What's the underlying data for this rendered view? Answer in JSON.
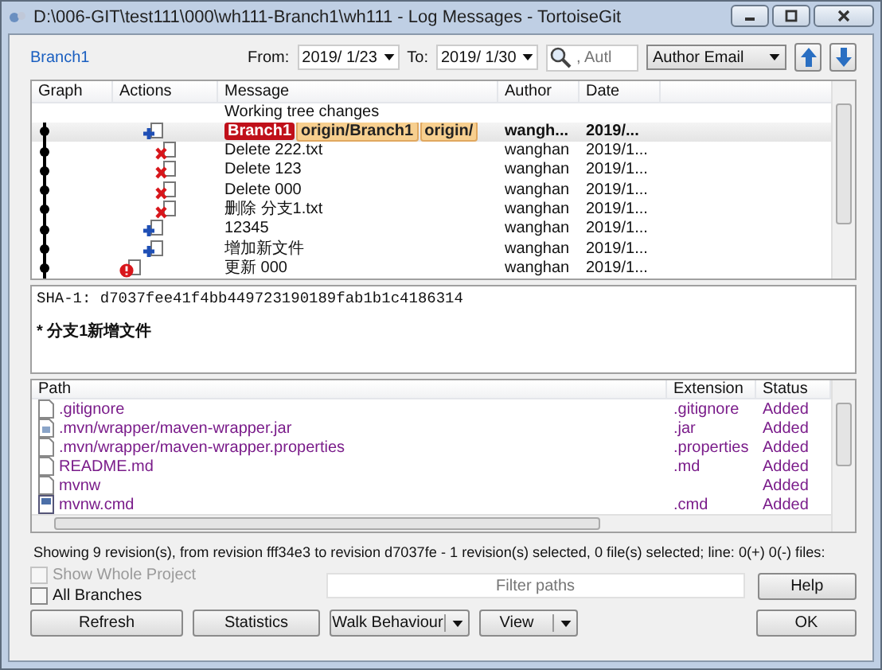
{
  "window": {
    "title": "D:\\006-GIT\\test111\\000\\wh111-Branch1\\wh111 - Log Messages - TortoiseGit"
  },
  "toolbar": {
    "branch_link": "Branch1",
    "from_label": "From:",
    "from_value": "2019/  1/23",
    "to_label": "To:",
    "to_value": "2019/  1/30",
    "search": {
      "placeholder": ", Autl"
    },
    "filter_field": "Author Email"
  },
  "log": {
    "columns": [
      "Graph",
      "Actions",
      "Message",
      "Author",
      "Date"
    ],
    "rows": [
      {
        "graph_node": false,
        "kind": "worktree",
        "message": "Working tree changes",
        "author": "",
        "date": "",
        "selected": false,
        "refs": []
      },
      {
        "graph_node": true,
        "kind": "add",
        "message": "",
        "author": "wangh...",
        "date": "2019/...",
        "selected": true,
        "refs": [
          {
            "kind": "local",
            "name": "Branch1"
          },
          {
            "kind": "remote",
            "name": "origin/Branch1"
          },
          {
            "kind": "remote",
            "name": "origin/"
          }
        ]
      },
      {
        "graph_node": true,
        "kind": "delete",
        "message": "Delete 222.txt",
        "author": "wanghan",
        "date": "2019/1...",
        "selected": false,
        "refs": []
      },
      {
        "graph_node": true,
        "kind": "delete",
        "message": "Delete 123",
        "author": "wanghan",
        "date": "2019/1...",
        "selected": false,
        "refs": []
      },
      {
        "graph_node": true,
        "kind": "delete",
        "message": "Delete 000",
        "author": "wanghan",
        "date": "2019/1...",
        "selected": false,
        "refs": []
      },
      {
        "graph_node": true,
        "kind": "delete",
        "message": "删除 分支1.txt",
        "author": "wanghan",
        "date": "2019/1...",
        "selected": false,
        "refs": []
      },
      {
        "graph_node": true,
        "kind": "add",
        "message": "12345",
        "author": "wanghan",
        "date": "2019/1...",
        "selected": false,
        "refs": []
      },
      {
        "graph_node": true,
        "kind": "add",
        "message": "增加新文件",
        "author": "wanghan",
        "date": "2019/1...",
        "selected": false,
        "refs": []
      },
      {
        "graph_node": true,
        "kind": "error",
        "message": "更新 000",
        "author": "wanghan",
        "date": "2019/1...",
        "selected": false,
        "refs": []
      }
    ]
  },
  "message_pane": {
    "sha": "SHA-1: d7037fee41f4bb449723190189fab1b1c4186314",
    "body": "* 分支1新增文件"
  },
  "files": {
    "columns": [
      "Path",
      "Extension",
      "Status"
    ],
    "rows": [
      {
        "kind": "text",
        "path": ".gitignore",
        "extension": ".gitignore",
        "status": "Added"
      },
      {
        "kind": "image",
        "path": ".mvn/wrapper/maven-wrapper.jar",
        "extension": ".jar",
        "status": "Added"
      },
      {
        "kind": "text",
        "path": ".mvn/wrapper/maven-wrapper.properties",
        "extension": ".properties",
        "status": "Added"
      },
      {
        "kind": "text",
        "path": "README.md",
        "extension": ".md",
        "status": "Added"
      },
      {
        "kind": "text",
        "path": "mvnw",
        "extension": "",
        "status": "Added"
      },
      {
        "kind": "script",
        "path": "mvnw.cmd",
        "extension": ".cmd",
        "status": "Added"
      }
    ]
  },
  "status_line": "Showing 9 revision(s), from revision fff34e3 to revision d7037fe - 1 revision(s) selected, 0 file(s) selected; line: 0(+) 0(-) files:",
  "options": [
    {
      "label": "Show Whole Project",
      "checked": false,
      "disabled": true
    },
    {
      "label": "All Branches",
      "checked": false,
      "disabled": false
    }
  ],
  "filter_paths": {
    "placeholder": "Filter paths"
  },
  "buttons": [
    {
      "label": "Refresh",
      "kind": "plain"
    },
    {
      "label": "Statistics",
      "kind": "plain"
    },
    {
      "label": "Walk Behaviour",
      "kind": "split"
    },
    {
      "label": "View",
      "kind": "split"
    }
  ],
  "help_button": "Help",
  "ok_button": "OK"
}
